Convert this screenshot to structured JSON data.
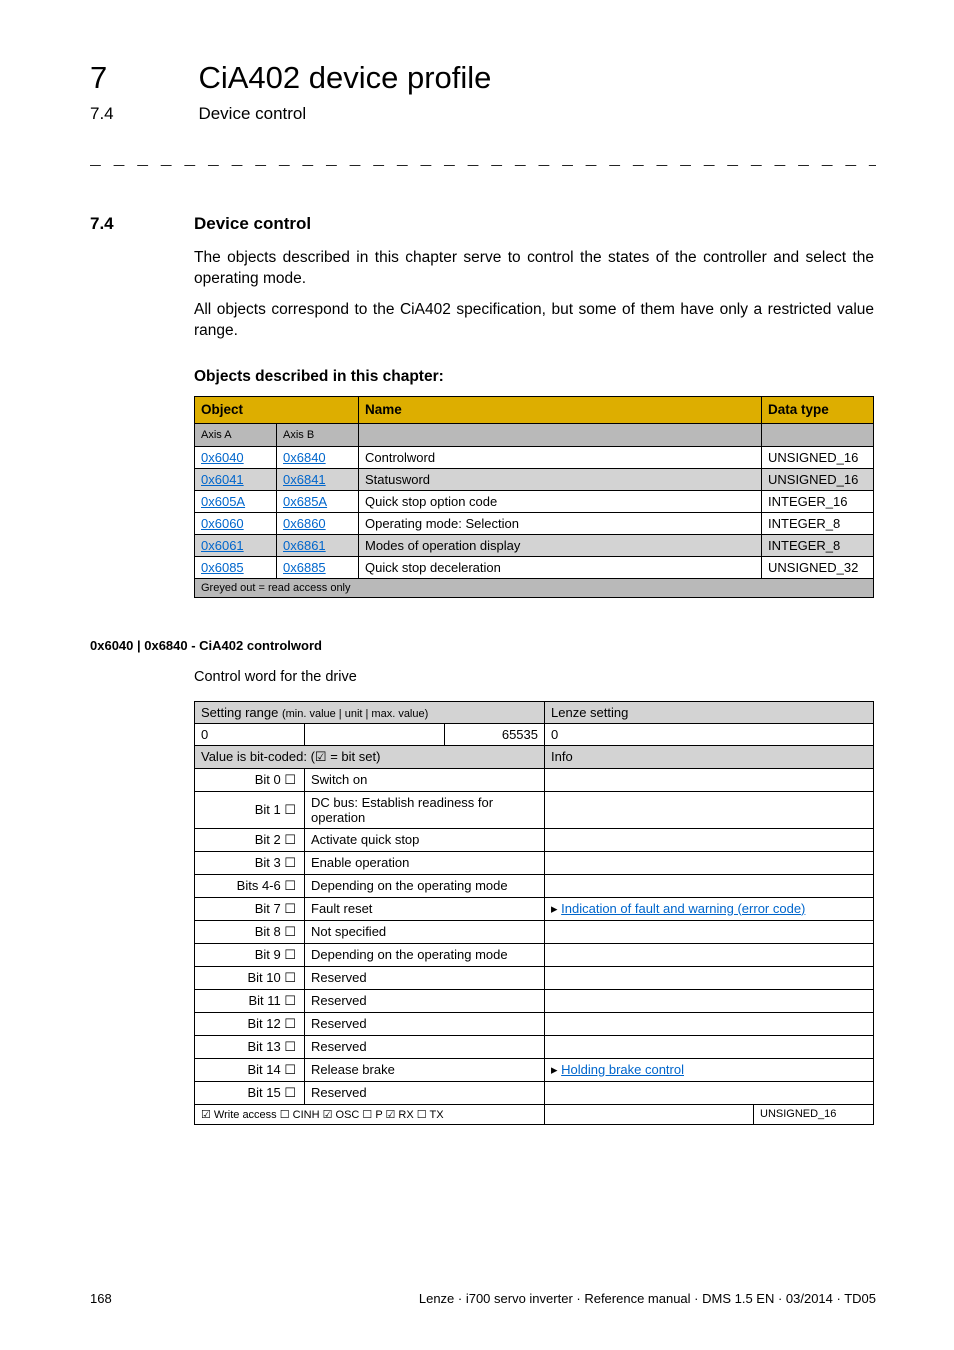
{
  "header": {
    "chapter_num": "7",
    "chapter_title": "CiA402 device profile",
    "sub_num": "7.4",
    "sub_title": "Device control",
    "dashes": "_ _ _ _ _ _ _ _ _ _ _ _ _ _ _ _ _ _ _ _ _ _ _ _ _ _ _ _ _ _ _ _ _ _ _ _ _ _ _ _ _ _ _ _ _ _ _ _ _ _ _ _ _ _ _ _ _ _ _ _ _ _ _ _"
  },
  "section": {
    "num": "7.4",
    "title": "Device control"
  },
  "paras": {
    "p1": "The objects described in this chapter serve to control the states of the controller and select the operating mode.",
    "p2": "All objects correspond to the CiA402 specification, but some of them have only a restricted value range.",
    "subhead": "Objects described in this chapter:"
  },
  "table1": {
    "headers": {
      "object": "Object",
      "name": "Name",
      "datatype": "Data type",
      "axisA": "Axis A",
      "axisB": "Axis B"
    },
    "rows": [
      {
        "a": "0x6040",
        "b": "0x6840",
        "name": "Controlword",
        "dt": "UNSIGNED_16",
        "grey": false
      },
      {
        "a": "0x6041",
        "b": "0x6841",
        "name": "Statusword",
        "dt": "UNSIGNED_16",
        "grey": true
      },
      {
        "a": "0x605A",
        "b": "0x685A",
        "name": "Quick stop option code",
        "dt": "INTEGER_16",
        "grey": false
      },
      {
        "a": "0x6060",
        "b": "0x6860",
        "name": "Operating mode: Selection",
        "dt": "INTEGER_8",
        "grey": false
      },
      {
        "a": "0x6061",
        "b": "0x6861",
        "name": "Modes of operation display",
        "dt": "INTEGER_8",
        "grey": true
      },
      {
        "a": "0x6085",
        "b": "0x6885",
        "name": "Quick stop deceleration",
        "dt": "UNSIGNED_32",
        "grey": false
      }
    ],
    "footer": "Greyed out = read access only"
  },
  "obj_section": {
    "title": "0x6040 | 0x6840 - CiA402 controlword",
    "desc": "Control word for the drive"
  },
  "table2": {
    "head": {
      "setting": "Setting range (min. value | unit | max. value)",
      "lenze": "Lenze setting"
    },
    "row_range": {
      "min": "0",
      "max": "65535",
      "def": "0"
    },
    "bitcoded_label": "Value is bit-coded: (☑ = bit set)",
    "info_label": "Info",
    "bits": [
      {
        "bit": "Bit 0 ☐",
        "desc": "Switch on",
        "info": ""
      },
      {
        "bit": "Bit 1 ☐",
        "desc": "DC bus: Establish readiness for operation",
        "info": ""
      },
      {
        "bit": "Bit 2 ☐",
        "desc": "Activate quick stop",
        "info": ""
      },
      {
        "bit": "Bit 3 ☐",
        "desc": "Enable operation",
        "info": ""
      },
      {
        "bit": "Bits 4-6 ☐",
        "desc": "Depending on the operating mode",
        "info": ""
      },
      {
        "bit": "Bit 7 ☐",
        "desc": "Fault reset",
        "info_link": "Indication of fault and warning (error code)"
      },
      {
        "bit": "Bit 8 ☐",
        "desc": "Not specified",
        "info": ""
      },
      {
        "bit": "Bit 9 ☐",
        "desc": "Depending on the operating mode",
        "info": ""
      },
      {
        "bit": "Bit 10 ☐",
        "desc": "Reserved",
        "info": ""
      },
      {
        "bit": "Bit 11 ☐",
        "desc": "Reserved",
        "info": ""
      },
      {
        "bit": "Bit 12 ☐",
        "desc": "Reserved",
        "info": ""
      },
      {
        "bit": "Bit 13 ☐",
        "desc": "Reserved",
        "info": ""
      },
      {
        "bit": "Bit 14 ☐",
        "desc": "Release brake",
        "info_link": "Holding brake control"
      },
      {
        "bit": "Bit 15 ☐",
        "desc": "Reserved",
        "info": ""
      }
    ],
    "footer_left": "☑ Write access  ☐ CINH  ☑ OSC  ☐ P  ☑ RX  ☐ TX",
    "footer_right": "UNSIGNED_16"
  },
  "footer": {
    "page": "168",
    "meta": "Lenze · i700 servo inverter · Reference manual · DMS 1.5 EN · 03/2014 · TD05"
  }
}
